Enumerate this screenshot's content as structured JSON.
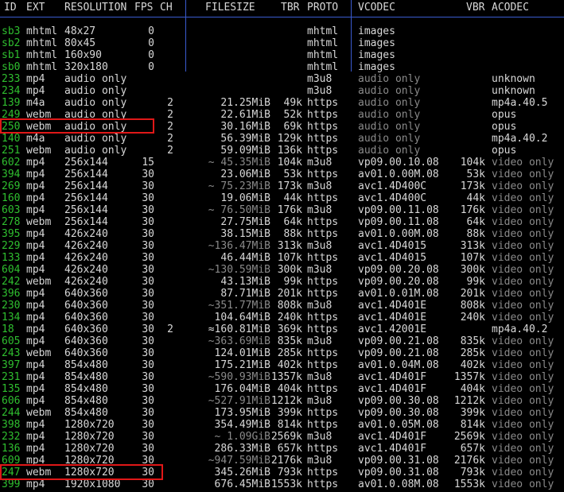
{
  "header": {
    "id": "ID",
    "ext": "EXT",
    "resolution": "RESOLUTION",
    "fps": "FPS",
    "ch": "CH",
    "filesize": "FILESIZE",
    "tbr": "TBR",
    "proto": "PROTO",
    "vcodec": "VCODEC",
    "vbr": "VBR",
    "acodec": "ACODEC"
  },
  "rows": [
    {
      "id": "sb3",
      "ext": "mhtml",
      "res": "48x27",
      "fps": "0",
      "ch": "",
      "size": "",
      "tbr": "",
      "proto": "mhtml",
      "vcodec": "images",
      "vbr": "",
      "acodec": ""
    },
    {
      "id": "sb2",
      "ext": "mhtml",
      "res": "80x45",
      "fps": "0",
      "ch": "",
      "size": "",
      "tbr": "",
      "proto": "mhtml",
      "vcodec": "images",
      "vbr": "",
      "acodec": ""
    },
    {
      "id": "sb1",
      "ext": "mhtml",
      "res": "160x90",
      "fps": "0",
      "ch": "",
      "size": "",
      "tbr": "",
      "proto": "mhtml",
      "vcodec": "images",
      "vbr": "",
      "acodec": ""
    },
    {
      "id": "sb0",
      "ext": "mhtml",
      "res": "320x180",
      "fps": "0",
      "ch": "",
      "size": "",
      "tbr": "",
      "proto": "mhtml",
      "vcodec": "images",
      "vbr": "",
      "acodec": ""
    },
    {
      "id": "233",
      "ext": "mp4",
      "res": "audio only",
      "fps": "",
      "ch": "",
      "size": "",
      "tbr": "",
      "proto": "m3u8",
      "vcodec": "audio only",
      "vbr": "",
      "acodec": "unknown"
    },
    {
      "id": "234",
      "ext": "mp4",
      "res": "audio only",
      "fps": "",
      "ch": "",
      "size": "",
      "tbr": "",
      "proto": "m3u8",
      "vcodec": "audio only",
      "vbr": "",
      "acodec": "unknown"
    },
    {
      "id": "139",
      "ext": "m4a",
      "res": "audio only",
      "fps": "",
      "ch": "2",
      "size": "21.25MiB",
      "tbr": "49k",
      "proto": "https",
      "vcodec": "audio only",
      "vbr": "",
      "acodec": "mp4a.40.5"
    },
    {
      "id": "249",
      "ext": "webm",
      "res": "audio only",
      "fps": "",
      "ch": "2",
      "size": "22.61MiB",
      "tbr": "52k",
      "proto": "https",
      "vcodec": "audio only",
      "vbr": "",
      "acodec": "opus"
    },
    {
      "id": "250",
      "ext": "webm",
      "res": "audio only",
      "fps": "",
      "ch": "2",
      "size": "30.16MiB",
      "tbr": "69k",
      "proto": "https",
      "vcodec": "audio only",
      "vbr": "",
      "acodec": "opus"
    },
    {
      "id": "140",
      "ext": "m4a",
      "res": "audio only",
      "fps": "",
      "ch": "2",
      "size": "56.39MiB",
      "tbr": "129k",
      "proto": "https",
      "vcodec": "audio only",
      "vbr": "",
      "acodec": "mp4a.40.2"
    },
    {
      "id": "251",
      "ext": "webm",
      "res": "audio only",
      "fps": "",
      "ch": "2",
      "size": "59.09MiB",
      "tbr": "136k",
      "proto": "https",
      "vcodec": "audio only",
      "vbr": "",
      "acodec": "opus"
    },
    {
      "id": "602",
      "ext": "mp4",
      "res": "256x144",
      "fps": "15",
      "ch": "",
      "size": "~ 45.35MiB",
      "tbr": "104k",
      "proto": "m3u8",
      "vcodec": "vp09.00.10.08",
      "vbr": "104k",
      "acodec": "video only"
    },
    {
      "id": "394",
      "ext": "mp4",
      "res": "256x144",
      "fps": "30",
      "ch": "",
      "size": "23.06MiB",
      "tbr": "53k",
      "proto": "https",
      "vcodec": "av01.0.00M.08",
      "vbr": "53k",
      "acodec": "video only"
    },
    {
      "id": "269",
      "ext": "mp4",
      "res": "256x144",
      "fps": "30",
      "ch": "",
      "size": "~ 75.23MiB",
      "tbr": "173k",
      "proto": "m3u8",
      "vcodec": "avc1.4D400C",
      "vbr": "173k",
      "acodec": "video only"
    },
    {
      "id": "160",
      "ext": "mp4",
      "res": "256x144",
      "fps": "30",
      "ch": "",
      "size": "19.06MiB",
      "tbr": "44k",
      "proto": "https",
      "vcodec": "avc1.4D400C",
      "vbr": "44k",
      "acodec": "video only"
    },
    {
      "id": "603",
      "ext": "mp4",
      "res": "256x144",
      "fps": "30",
      "ch": "",
      "size": "~ 76.50MiB",
      "tbr": "176k",
      "proto": "m3u8",
      "vcodec": "vp09.00.11.08",
      "vbr": "176k",
      "acodec": "video only"
    },
    {
      "id": "278",
      "ext": "webm",
      "res": "256x144",
      "fps": "30",
      "ch": "",
      "size": "27.75MiB",
      "tbr": "64k",
      "proto": "https",
      "vcodec": "vp09.00.11.08",
      "vbr": "64k",
      "acodec": "video only"
    },
    {
      "id": "395",
      "ext": "mp4",
      "res": "426x240",
      "fps": "30",
      "ch": "",
      "size": "38.15MiB",
      "tbr": "88k",
      "proto": "https",
      "vcodec": "av01.0.00M.08",
      "vbr": "88k",
      "acodec": "video only"
    },
    {
      "id": "229",
      "ext": "mp4",
      "res": "426x240",
      "fps": "30",
      "ch": "",
      "size": "~136.47MiB",
      "tbr": "313k",
      "proto": "m3u8",
      "vcodec": "avc1.4D4015",
      "vbr": "313k",
      "acodec": "video only"
    },
    {
      "id": "133",
      "ext": "mp4",
      "res": "426x240",
      "fps": "30",
      "ch": "",
      "size": "46.44MiB",
      "tbr": "107k",
      "proto": "https",
      "vcodec": "avc1.4D4015",
      "vbr": "107k",
      "acodec": "video only"
    },
    {
      "id": "604",
      "ext": "mp4",
      "res": "426x240",
      "fps": "30",
      "ch": "",
      "size": "~130.59MiB",
      "tbr": "300k",
      "proto": "m3u8",
      "vcodec": "vp09.00.20.08",
      "vbr": "300k",
      "acodec": "video only"
    },
    {
      "id": "242",
      "ext": "webm",
      "res": "426x240",
      "fps": "30",
      "ch": "",
      "size": "43.13MiB",
      "tbr": "99k",
      "proto": "https",
      "vcodec": "vp09.00.20.08",
      "vbr": "99k",
      "acodec": "video only"
    },
    {
      "id": "396",
      "ext": "mp4",
      "res": "640x360",
      "fps": "30",
      "ch": "",
      "size": "87.71MiB",
      "tbr": "201k",
      "proto": "https",
      "vcodec": "av01.0.01M.08",
      "vbr": "201k",
      "acodec": "video only"
    },
    {
      "id": "230",
      "ext": "mp4",
      "res": "640x360",
      "fps": "30",
      "ch": "",
      "size": "~351.77MiB",
      "tbr": "808k",
      "proto": "m3u8",
      "vcodec": "avc1.4D401E",
      "vbr": "808k",
      "acodec": "video only"
    },
    {
      "id": "134",
      "ext": "mp4",
      "res": "640x360",
      "fps": "30",
      "ch": "",
      "size": "104.64MiB",
      "tbr": "240k",
      "proto": "https",
      "vcodec": "avc1.4D401E",
      "vbr": "240k",
      "acodec": "video only"
    },
    {
      "id": "18",
      "ext": "mp4",
      "res": "640x360",
      "fps": "30",
      "ch": "2",
      "size": "≈160.81MiB",
      "tbr": "369k",
      "proto": "https",
      "vcodec": "avc1.42001E",
      "vbr": "",
      "acodec": "mp4a.40.2"
    },
    {
      "id": "605",
      "ext": "mp4",
      "res": "640x360",
      "fps": "30",
      "ch": "",
      "size": "~363.69MiB",
      "tbr": "835k",
      "proto": "m3u8",
      "vcodec": "vp09.00.21.08",
      "vbr": "835k",
      "acodec": "video only"
    },
    {
      "id": "243",
      "ext": "webm",
      "res": "640x360",
      "fps": "30",
      "ch": "",
      "size": "124.01MiB",
      "tbr": "285k",
      "proto": "https",
      "vcodec": "vp09.00.21.08",
      "vbr": "285k",
      "acodec": "video only"
    },
    {
      "id": "397",
      "ext": "mp4",
      "res": "854x480",
      "fps": "30",
      "ch": "",
      "size": "175.21MiB",
      "tbr": "402k",
      "proto": "https",
      "vcodec": "av01.0.04M.08",
      "vbr": "402k",
      "acodec": "video only"
    },
    {
      "id": "231",
      "ext": "mp4",
      "res": "854x480",
      "fps": "30",
      "ch": "",
      "size": "~590.93MiB",
      "tbr": "1357k",
      "proto": "m3u8",
      "vcodec": "avc1.4D401F",
      "vbr": "1357k",
      "acodec": "video only"
    },
    {
      "id": "135",
      "ext": "mp4",
      "res": "854x480",
      "fps": "30",
      "ch": "",
      "size": "176.04MiB",
      "tbr": "404k",
      "proto": "https",
      "vcodec": "avc1.4D401F",
      "vbr": "404k",
      "acodec": "video only"
    },
    {
      "id": "606",
      "ext": "mp4",
      "res": "854x480",
      "fps": "30",
      "ch": "",
      "size": "~527.91MiB",
      "tbr": "1212k",
      "proto": "m3u8",
      "vcodec": "vp09.00.30.08",
      "vbr": "1212k",
      "acodec": "video only"
    },
    {
      "id": "244",
      "ext": "webm",
      "res": "854x480",
      "fps": "30",
      "ch": "",
      "size": "173.95MiB",
      "tbr": "399k",
      "proto": "https",
      "vcodec": "vp09.00.30.08",
      "vbr": "399k",
      "acodec": "video only"
    },
    {
      "id": "398",
      "ext": "mp4",
      "res": "1280x720",
      "fps": "30",
      "ch": "",
      "size": "354.49MiB",
      "tbr": "814k",
      "proto": "https",
      "vcodec": "av01.0.05M.08",
      "vbr": "814k",
      "acodec": "video only"
    },
    {
      "id": "232",
      "ext": "mp4",
      "res": "1280x720",
      "fps": "30",
      "ch": "",
      "size": "~ 1.09GiB",
      "tbr": "2569k",
      "proto": "m3u8",
      "vcodec": "avc1.4D401F",
      "vbr": "2569k",
      "acodec": "video only"
    },
    {
      "id": "136",
      "ext": "mp4",
      "res": "1280x720",
      "fps": "30",
      "ch": "",
      "size": "286.33MiB",
      "tbr": "657k",
      "proto": "https",
      "vcodec": "avc1.4D401F",
      "vbr": "657k",
      "acodec": "video only"
    },
    {
      "id": "609",
      "ext": "mp4",
      "res": "1280x720",
      "fps": "30",
      "ch": "",
      "size": "~947.59MiB",
      "tbr": "2176k",
      "proto": "m3u8",
      "vcodec": "vp09.00.31.08",
      "vbr": "2176k",
      "acodec": "video only"
    },
    {
      "id": "247",
      "ext": "webm",
      "res": "1280x720",
      "fps": "30",
      "ch": "",
      "size": "345.26MiB",
      "tbr": "793k",
      "proto": "https",
      "vcodec": "vp09.00.31.08",
      "vbr": "793k",
      "acodec": "video only"
    },
    {
      "id": "399",
      "ext": "mp4",
      "res": "1920x1080",
      "fps": "30",
      "ch": "",
      "size": "676.45MiB",
      "tbr": "1553k",
      "proto": "https",
      "vcodec": "av01.0.08M.08",
      "vbr": "1553k",
      "acodec": "video only"
    }
  ],
  "colors": {
    "id_green": "#2fbf2f",
    "separator_blue": "#3a5bd0",
    "highlight_red": "#e01818",
    "dim_gray": "#8a8a8a",
    "text": "#d8d8d8"
  }
}
